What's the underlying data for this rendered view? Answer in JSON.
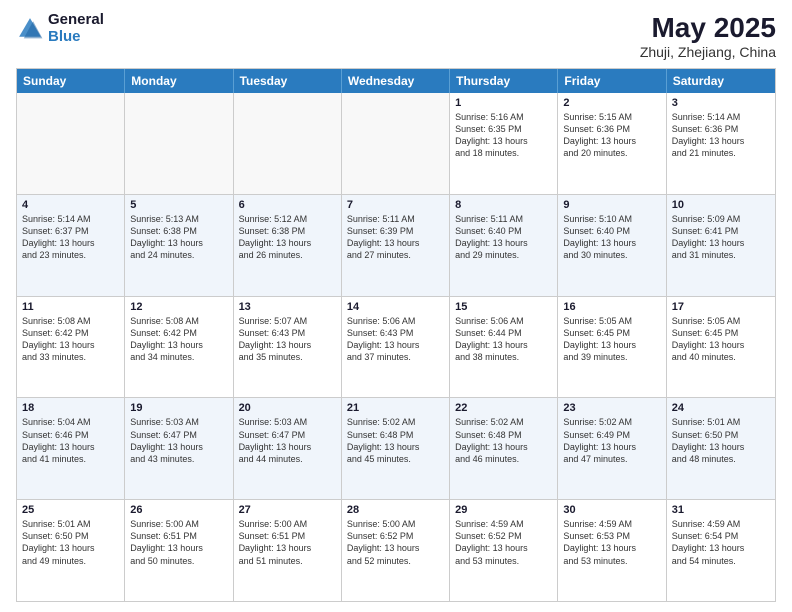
{
  "logo": {
    "general": "General",
    "blue": "Blue"
  },
  "title": "May 2025",
  "location": "Zhuji, Zhejiang, China",
  "days": [
    "Sunday",
    "Monday",
    "Tuesday",
    "Wednesday",
    "Thursday",
    "Friday",
    "Saturday"
  ],
  "rows": [
    [
      {
        "day": "",
        "text": ""
      },
      {
        "day": "",
        "text": ""
      },
      {
        "day": "",
        "text": ""
      },
      {
        "day": "",
        "text": ""
      },
      {
        "day": "1",
        "text": "Sunrise: 5:16 AM\nSunset: 6:35 PM\nDaylight: 13 hours\nand 18 minutes."
      },
      {
        "day": "2",
        "text": "Sunrise: 5:15 AM\nSunset: 6:36 PM\nDaylight: 13 hours\nand 20 minutes."
      },
      {
        "day": "3",
        "text": "Sunrise: 5:14 AM\nSunset: 6:36 PM\nDaylight: 13 hours\nand 21 minutes."
      }
    ],
    [
      {
        "day": "4",
        "text": "Sunrise: 5:14 AM\nSunset: 6:37 PM\nDaylight: 13 hours\nand 23 minutes."
      },
      {
        "day": "5",
        "text": "Sunrise: 5:13 AM\nSunset: 6:38 PM\nDaylight: 13 hours\nand 24 minutes."
      },
      {
        "day": "6",
        "text": "Sunrise: 5:12 AM\nSunset: 6:38 PM\nDaylight: 13 hours\nand 26 minutes."
      },
      {
        "day": "7",
        "text": "Sunrise: 5:11 AM\nSunset: 6:39 PM\nDaylight: 13 hours\nand 27 minutes."
      },
      {
        "day": "8",
        "text": "Sunrise: 5:11 AM\nSunset: 6:40 PM\nDaylight: 13 hours\nand 29 minutes."
      },
      {
        "day": "9",
        "text": "Sunrise: 5:10 AM\nSunset: 6:40 PM\nDaylight: 13 hours\nand 30 minutes."
      },
      {
        "day": "10",
        "text": "Sunrise: 5:09 AM\nSunset: 6:41 PM\nDaylight: 13 hours\nand 31 minutes."
      }
    ],
    [
      {
        "day": "11",
        "text": "Sunrise: 5:08 AM\nSunset: 6:42 PM\nDaylight: 13 hours\nand 33 minutes."
      },
      {
        "day": "12",
        "text": "Sunrise: 5:08 AM\nSunset: 6:42 PM\nDaylight: 13 hours\nand 34 minutes."
      },
      {
        "day": "13",
        "text": "Sunrise: 5:07 AM\nSunset: 6:43 PM\nDaylight: 13 hours\nand 35 minutes."
      },
      {
        "day": "14",
        "text": "Sunrise: 5:06 AM\nSunset: 6:43 PM\nDaylight: 13 hours\nand 37 minutes."
      },
      {
        "day": "15",
        "text": "Sunrise: 5:06 AM\nSunset: 6:44 PM\nDaylight: 13 hours\nand 38 minutes."
      },
      {
        "day": "16",
        "text": "Sunrise: 5:05 AM\nSunset: 6:45 PM\nDaylight: 13 hours\nand 39 minutes."
      },
      {
        "day": "17",
        "text": "Sunrise: 5:05 AM\nSunset: 6:45 PM\nDaylight: 13 hours\nand 40 minutes."
      }
    ],
    [
      {
        "day": "18",
        "text": "Sunrise: 5:04 AM\nSunset: 6:46 PM\nDaylight: 13 hours\nand 41 minutes."
      },
      {
        "day": "19",
        "text": "Sunrise: 5:03 AM\nSunset: 6:47 PM\nDaylight: 13 hours\nand 43 minutes."
      },
      {
        "day": "20",
        "text": "Sunrise: 5:03 AM\nSunset: 6:47 PM\nDaylight: 13 hours\nand 44 minutes."
      },
      {
        "day": "21",
        "text": "Sunrise: 5:02 AM\nSunset: 6:48 PM\nDaylight: 13 hours\nand 45 minutes."
      },
      {
        "day": "22",
        "text": "Sunrise: 5:02 AM\nSunset: 6:48 PM\nDaylight: 13 hours\nand 46 minutes."
      },
      {
        "day": "23",
        "text": "Sunrise: 5:02 AM\nSunset: 6:49 PM\nDaylight: 13 hours\nand 47 minutes."
      },
      {
        "day": "24",
        "text": "Sunrise: 5:01 AM\nSunset: 6:50 PM\nDaylight: 13 hours\nand 48 minutes."
      }
    ],
    [
      {
        "day": "25",
        "text": "Sunrise: 5:01 AM\nSunset: 6:50 PM\nDaylight: 13 hours\nand 49 minutes."
      },
      {
        "day": "26",
        "text": "Sunrise: 5:00 AM\nSunset: 6:51 PM\nDaylight: 13 hours\nand 50 minutes."
      },
      {
        "day": "27",
        "text": "Sunrise: 5:00 AM\nSunset: 6:51 PM\nDaylight: 13 hours\nand 51 minutes."
      },
      {
        "day": "28",
        "text": "Sunrise: 5:00 AM\nSunset: 6:52 PM\nDaylight: 13 hours\nand 52 minutes."
      },
      {
        "day": "29",
        "text": "Sunrise: 4:59 AM\nSunset: 6:52 PM\nDaylight: 13 hours\nand 53 minutes."
      },
      {
        "day": "30",
        "text": "Sunrise: 4:59 AM\nSunset: 6:53 PM\nDaylight: 13 hours\nand 53 minutes."
      },
      {
        "day": "31",
        "text": "Sunrise: 4:59 AM\nSunset: 6:54 PM\nDaylight: 13 hours\nand 54 minutes."
      }
    ]
  ]
}
